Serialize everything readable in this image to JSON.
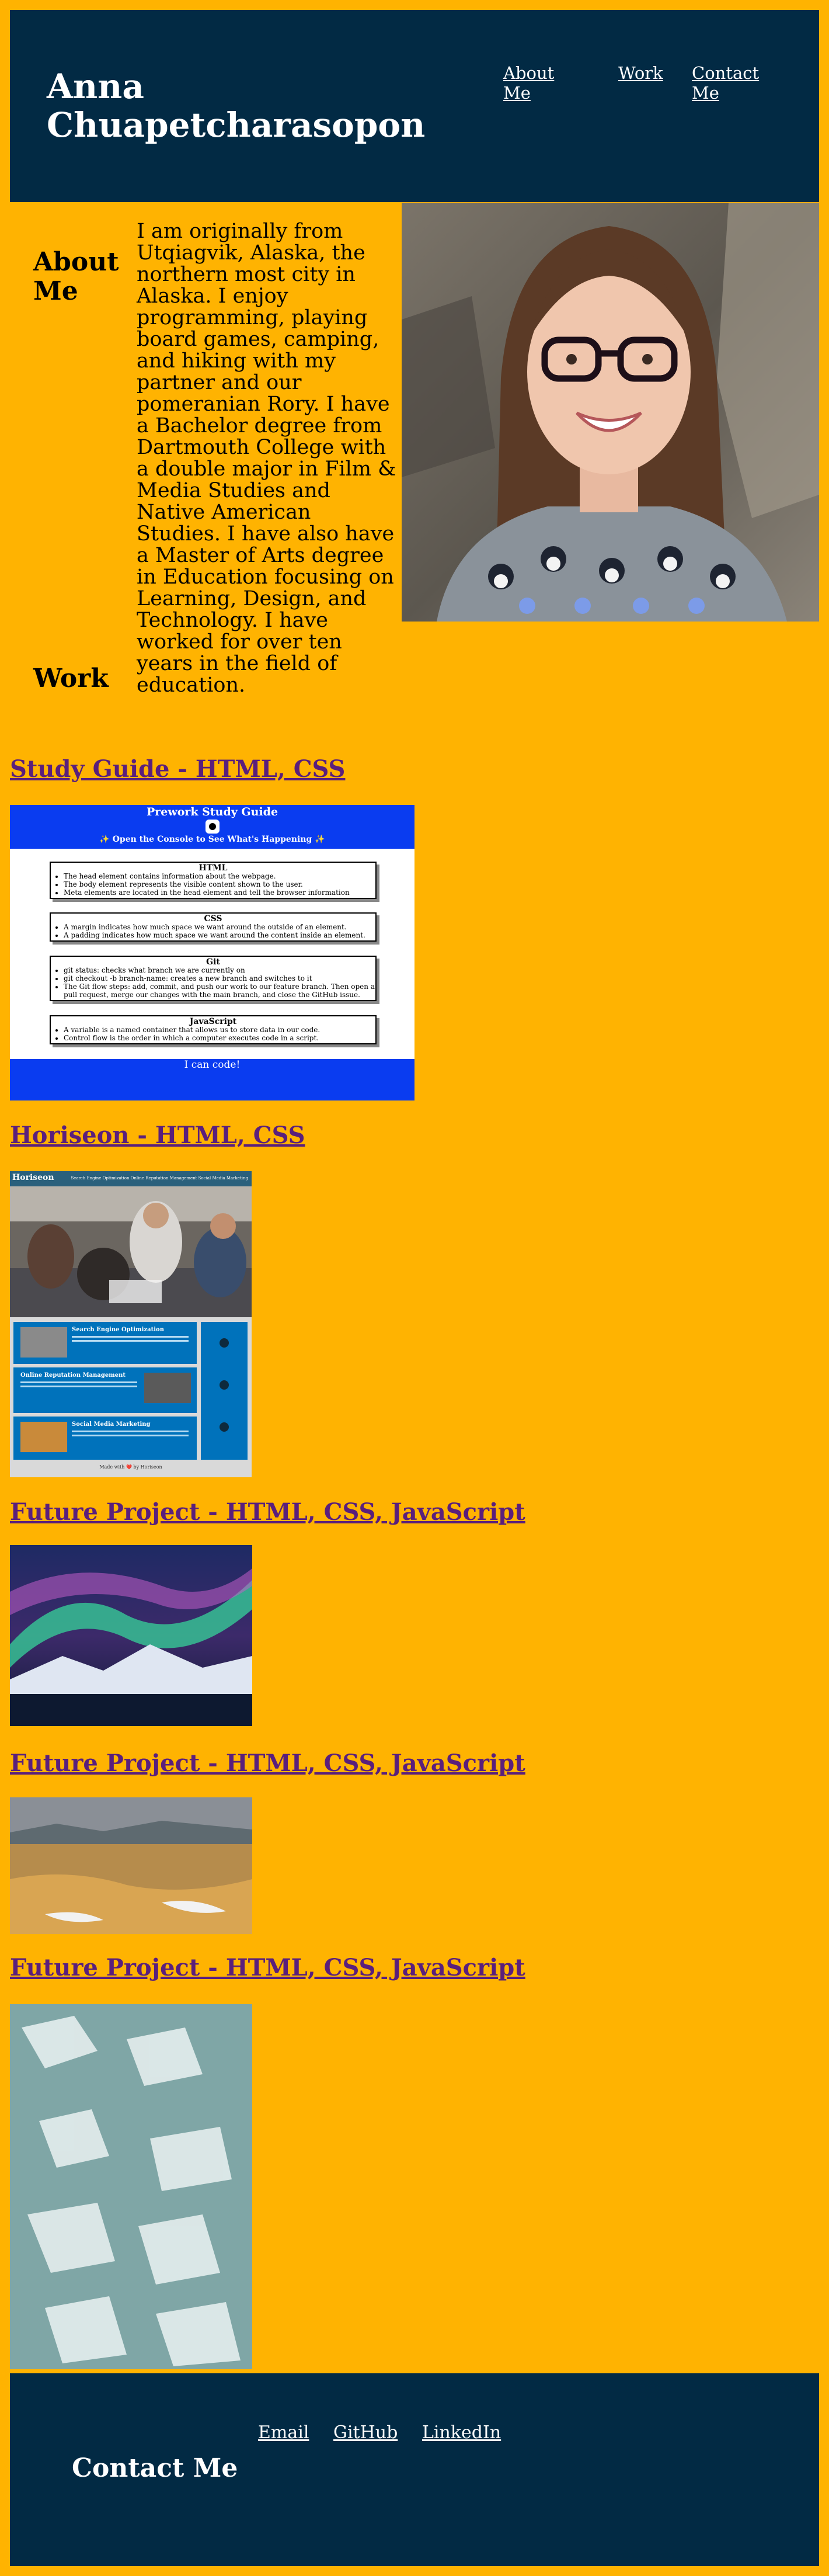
{
  "header": {
    "title": "Anna Chuapetcharasopon",
    "nav": [
      {
        "label": "About Me"
      },
      {
        "label": "Work"
      },
      {
        "label": "Contact Me"
      }
    ]
  },
  "about": {
    "heading": "About Me",
    "text": "I am originally from Utqiagvik, Alaska, the northern most city in Alaska. I enjoy programming, playing board games, camping, and hiking with my partner and our pomeranian Rory. I have a Bachelor degree from Dartmouth College with a double major in Film & Media Studies and Native American Studies. I have also have a Master of Arts degree in Education focusing on Learning, Design, and Technology. I have worked for over ten years in the field of education."
  },
  "work": {
    "heading": "Work",
    "projects": [
      {
        "title": "Study Guide - HTML, CSS"
      },
      {
        "title": "Horiseon - HTML, CSS"
      },
      {
        "title": "Future Project - HTML, CSS, JavaScript"
      },
      {
        "title": "Future Project - HTML, CSS, JavaScript"
      },
      {
        "title": "Future Project - HTML, CSS, JavaScript"
      }
    ]
  },
  "study_guide_shot": {
    "title": "Prework Study Guide",
    "subtitle": "✨ Open the Console to See What's Happening ✨",
    "cards": [
      {
        "heading": "HTML",
        "items": [
          "The head element contains information about the webpage.",
          "The body element represents the visible content shown to the user.",
          "Meta elements are located in the head element and tell the browser information"
        ]
      },
      {
        "heading": "CSS",
        "items": [
          "A margin indicates how much space we want around the outside of an element.",
          "A padding indicates how much space we want around the content inside an element."
        ]
      },
      {
        "heading": "Git",
        "items": [
          "git status: checks what branch we are currently on",
          "git checkout -b branch-name: creates a new branch and switches to it",
          "The Git flow steps: add, commit, and push our work to our feature branch. Then open a pull request, merge our changes with the main branch, and close the GitHub issue."
        ]
      },
      {
        "heading": "JavaScript",
        "items": [
          "A variable is a named container that allows us to store data in our code.",
          "Control flow is the order in which a computer executes code in a script."
        ]
      }
    ],
    "footer": "I can code!"
  },
  "horiseon_shot": {
    "brand": "Horiseon",
    "nav_links": "Search Engine Optimization   Online Reputation Management   Social Media Marketing",
    "sections": [
      "Search Engine Optimization",
      "Online Reputation Management",
      "Social Media Marketing"
    ],
    "footer": "Made with ❤️ by Horiseon"
  },
  "footer": {
    "heading": "Contact Me",
    "links": [
      {
        "label": "Email"
      },
      {
        "label": "GitHub"
      },
      {
        "label": "LinkedIn"
      }
    ]
  },
  "colors": {
    "background": "#ffb301",
    "navy": "#022a44",
    "link_purple": "#5a1f7c",
    "study_blue": "#0a3cf0",
    "horiseon_blue": "#0072bb"
  }
}
